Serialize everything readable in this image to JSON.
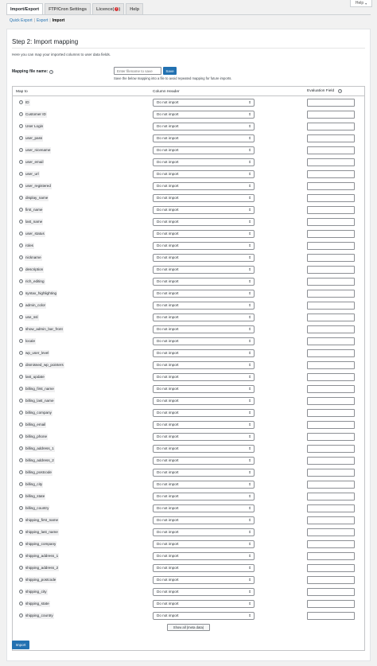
{
  "help": {
    "label": "Help"
  },
  "tabs": [
    {
      "label": "Import/Export",
      "active": true
    },
    {
      "label": "FTP/Cron Settings",
      "active": false
    },
    {
      "label": "Licence",
      "active": false,
      "badge": "!"
    },
    {
      "label": "Help",
      "active": false
    }
  ],
  "subnav": {
    "quick_export": "Quick Export",
    "export": "Export",
    "import": "Import",
    "sep": "|"
  },
  "step": {
    "title": "Step 2: Import mapping",
    "intro": "Here you can map your imported columns to user data fields."
  },
  "mapping": {
    "label": "Mapping file name:",
    "placeholder": "Enter filename to save",
    "save_label": "Save",
    "hint": "Save the below mapping into a file to avoid repeated mapping for future imports."
  },
  "table": {
    "headers": {
      "map_to": "Map to",
      "column_header": "Column Header",
      "evaluation_field": "Evaluation Field"
    },
    "default_option": "Do not import",
    "fields": [
      "ID",
      "Customer ID",
      "User Login",
      "user_pass",
      "user_nicename",
      "user_email",
      "user_url",
      "user_registered",
      "display_name",
      "first_name",
      "last_name",
      "user_status",
      "roles",
      "nickname",
      "description",
      "rich_editing",
      "syntax_highlighting",
      "admin_color",
      "use_ssl",
      "show_admin_bar_front",
      "locale",
      "wp_user_level",
      "dismissed_wp_pointers",
      "last_update",
      "billing_first_name",
      "billing_last_name",
      "billing_company",
      "billing_email",
      "billing_phone",
      "billing_address_1",
      "billing_address_2",
      "billing_postcode",
      "billing_city",
      "billing_state",
      "billing_country",
      "shipping_first_name",
      "shipping_last_name",
      "shipping_company",
      "shipping_address_1",
      "shipping_address_2",
      "shipping_postcode",
      "shipping_city",
      "shipping_state",
      "shipping_country"
    ]
  },
  "buttons": {
    "show_meta": "Show all (meta data)",
    "import": "Import"
  },
  "colors": {
    "primary": "#2271b1",
    "badge": "#d63638"
  }
}
